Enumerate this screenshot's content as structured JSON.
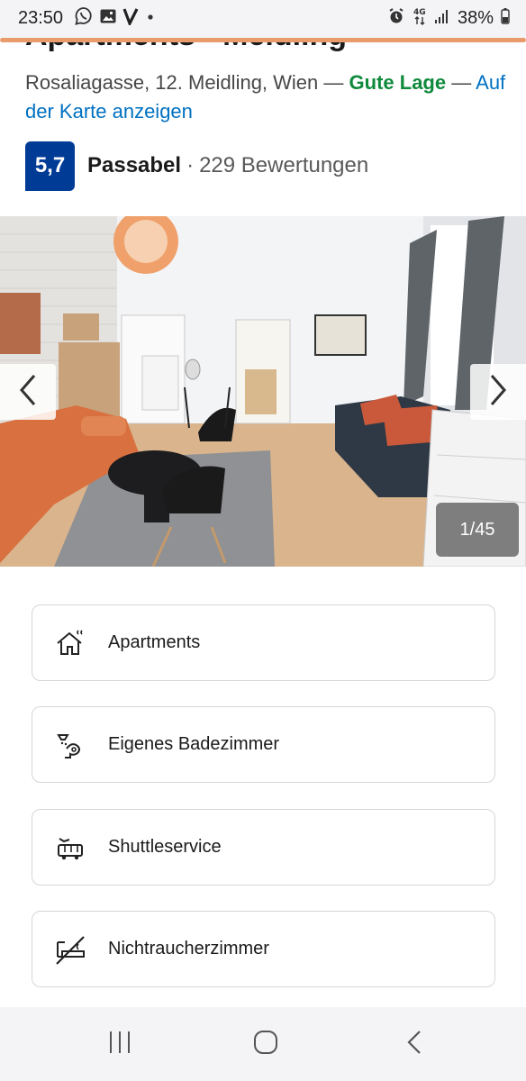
{
  "status_bar": {
    "time": "23:50",
    "battery": "38%",
    "icons_left": [
      "viber-icon",
      "gallery-icon",
      "v-app-icon",
      "dot-icon"
    ],
    "icons_right": [
      "alarm-icon",
      "4g-icon",
      "signal-icon",
      "battery-icon"
    ]
  },
  "property": {
    "title": "Apartments - Meidling",
    "address": "Rosaliagasse, 12. Meidling, Wien",
    "separator": "—",
    "location_rating": "Gute Lage",
    "map_link": "Auf der Karte anzeigen",
    "score": "5,7",
    "score_word": "Passabel",
    "dot": "·",
    "reviews": "229 Bewertungen"
  },
  "gallery": {
    "counter": "1/45",
    "prev_icon": "chevron-left-icon",
    "next_icon": "chevron-right-icon"
  },
  "facilities": [
    {
      "label": "Apartments",
      "icon": "house-icon"
    },
    {
      "label": "Eigenes Badezimmer",
      "icon": "shower-icon"
    },
    {
      "label": "Shuttleservice",
      "icon": "shuttle-bus-icon"
    },
    {
      "label": "Nichtraucherzimmer",
      "icon": "no-smoking-icon"
    }
  ],
  "colors": {
    "brand_blue": "#003b95",
    "link_blue": "#0071c2",
    "good_green": "#0f8a3c",
    "accent_orange": "#ea9b6c"
  }
}
